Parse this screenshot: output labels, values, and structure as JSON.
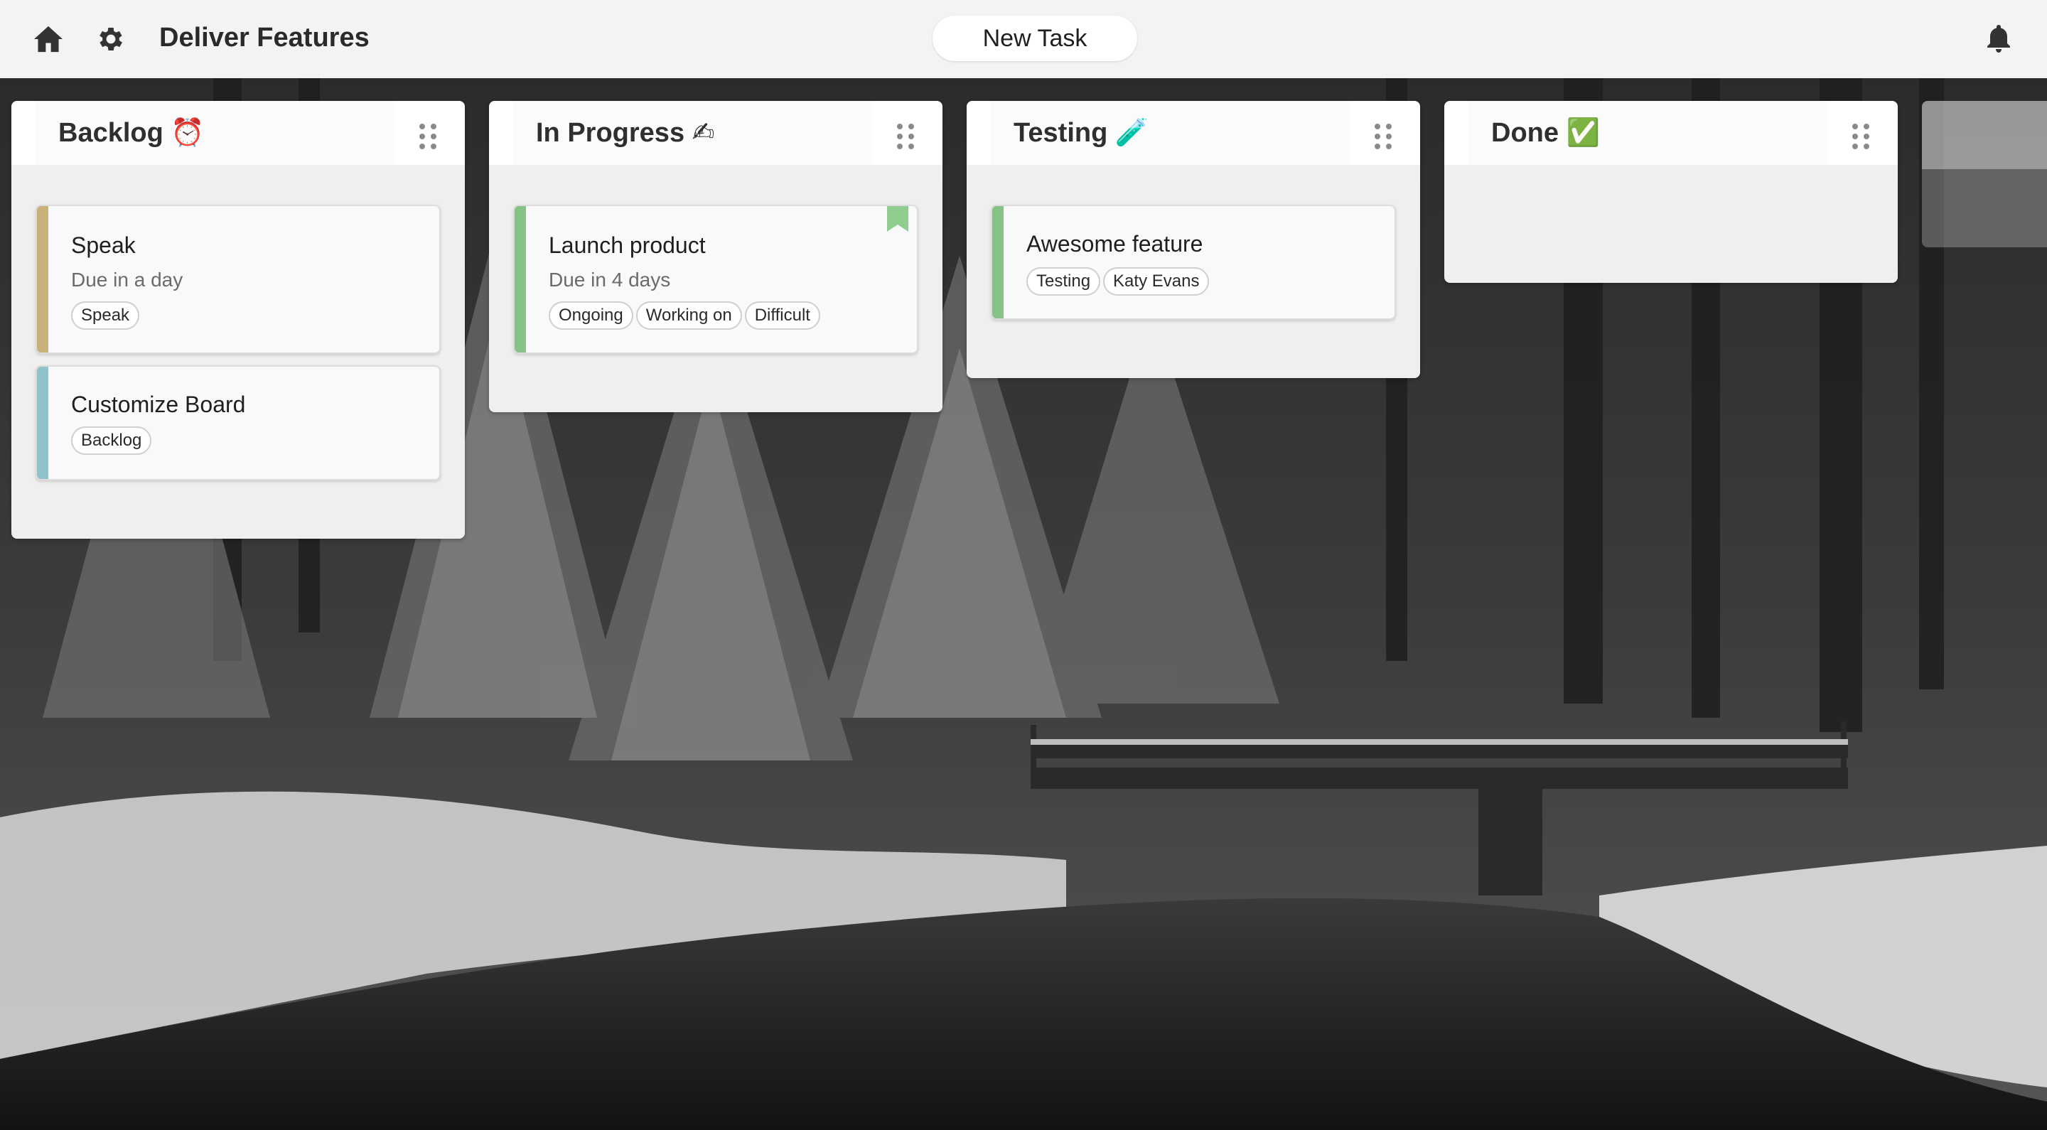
{
  "header": {
    "board_title": "Deliver Features",
    "new_task_label": "New Task",
    "icons": [
      "home-icon",
      "gear-icon",
      "bell-icon"
    ]
  },
  "columns": [
    {
      "title": "Backlog ⏰",
      "cards": [
        {
          "title": "Speak",
          "due": "Due in a day",
          "tags": [
            "Speak"
          ],
          "accent": "#c8b27a"
        },
        {
          "title": "Customize Board",
          "due": "",
          "tags": [
            "Backlog"
          ],
          "accent": "#8fc3c9"
        }
      ]
    },
    {
      "title": "In Progress ✍",
      "cards": [
        {
          "title": "Launch product",
          "due": "Due in 4 days",
          "tags": [
            "Ongoing",
            "Working on",
            "Difficult"
          ],
          "accent": "#86c286",
          "bookmarked": true
        }
      ]
    },
    {
      "title": "Testing 🧪",
      "cards": [
        {
          "title": "Awesome feature",
          "due": "",
          "tags": [
            "Testing",
            "Katy Evans"
          ],
          "accent": "#86c286"
        }
      ]
    },
    {
      "title": "Done ✅",
      "cards": []
    }
  ],
  "colors": {
    "topbar": "#f2f3f5",
    "column_bg": "#f0efee",
    "bookmark": "#8fce8f"
  }
}
